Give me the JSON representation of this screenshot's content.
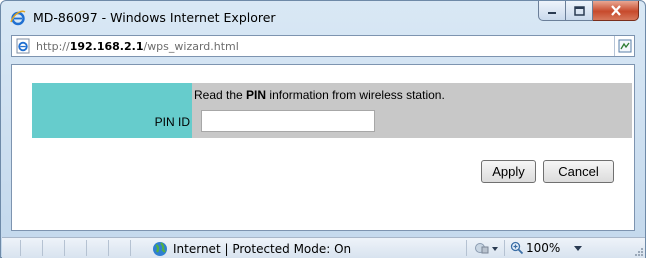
{
  "window": {
    "title": "MD-86097 - Windows Internet Explorer",
    "url_host": "http://192.168.2.1",
    "url_host_prefix": "http://",
    "url_host_bold": "192.168.2.1",
    "url_path": "/wps_wizard.html"
  },
  "form": {
    "instruction_prefix": "Read the ",
    "instruction_bold": "PIN",
    "instruction_suffix": " information from wireless station.",
    "pin_label": "PIN ID",
    "pin_value": "",
    "apply_label": "Apply",
    "cancel_label": "Cancel"
  },
  "statusbar": {
    "zone_text": "Internet | Protected Mode: On",
    "zoom_text": "100%"
  },
  "colors": {
    "accent_cell": "#66cccc",
    "form_background": "#c8c8c8"
  }
}
